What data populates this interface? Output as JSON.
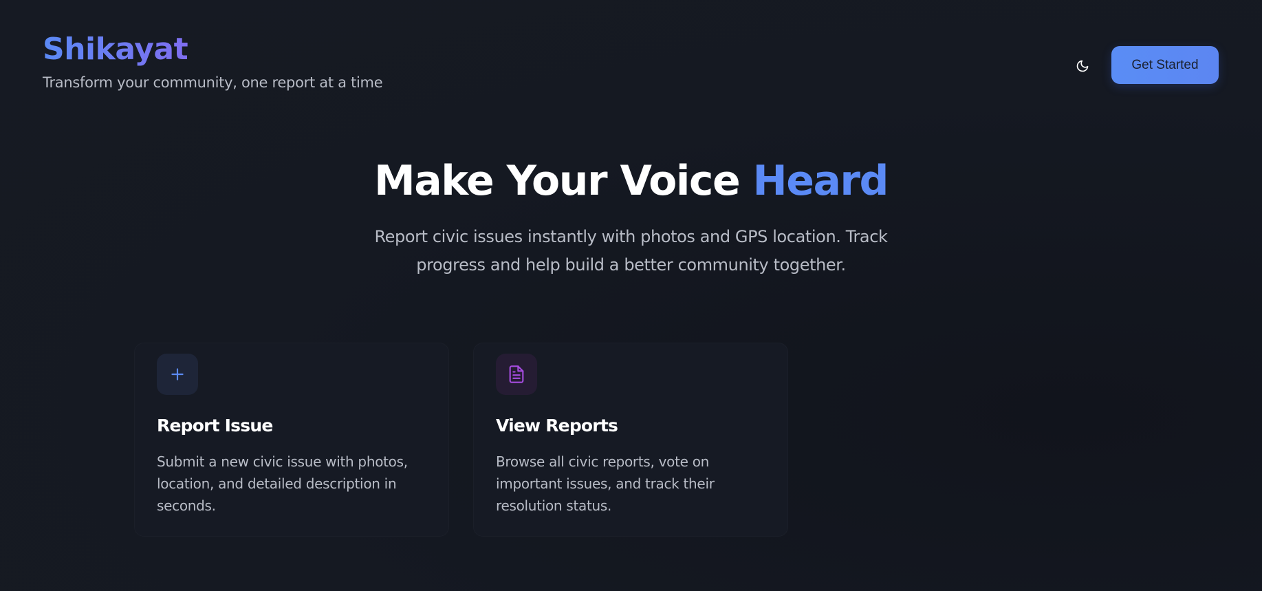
{
  "header": {
    "brand_title": "Shikayat",
    "tagline": "Transform your community, one report at a time",
    "theme_toggle_icon": "moon-icon",
    "cta_label": "Get Started"
  },
  "hero": {
    "title_main": "Make Your Voice ",
    "title_accent": "Heard",
    "subtitle": "Report civic issues instantly with photos and GPS location. Track progress and help build a better community together."
  },
  "cards": [
    {
      "icon": "plus-icon",
      "title": "Report Issue",
      "description": "Submit a new civic issue with photos, location, and detailed description in seconds."
    },
    {
      "icon": "document-icon",
      "title": "View Reports",
      "description": "Browse all civic reports, vote on important issues, and track their resolution status."
    }
  ],
  "colors": {
    "background": "#151922",
    "accent_blue": "#5b8af5",
    "accent_purple": "#a64ce0",
    "muted_text": "#b8bcc6"
  }
}
